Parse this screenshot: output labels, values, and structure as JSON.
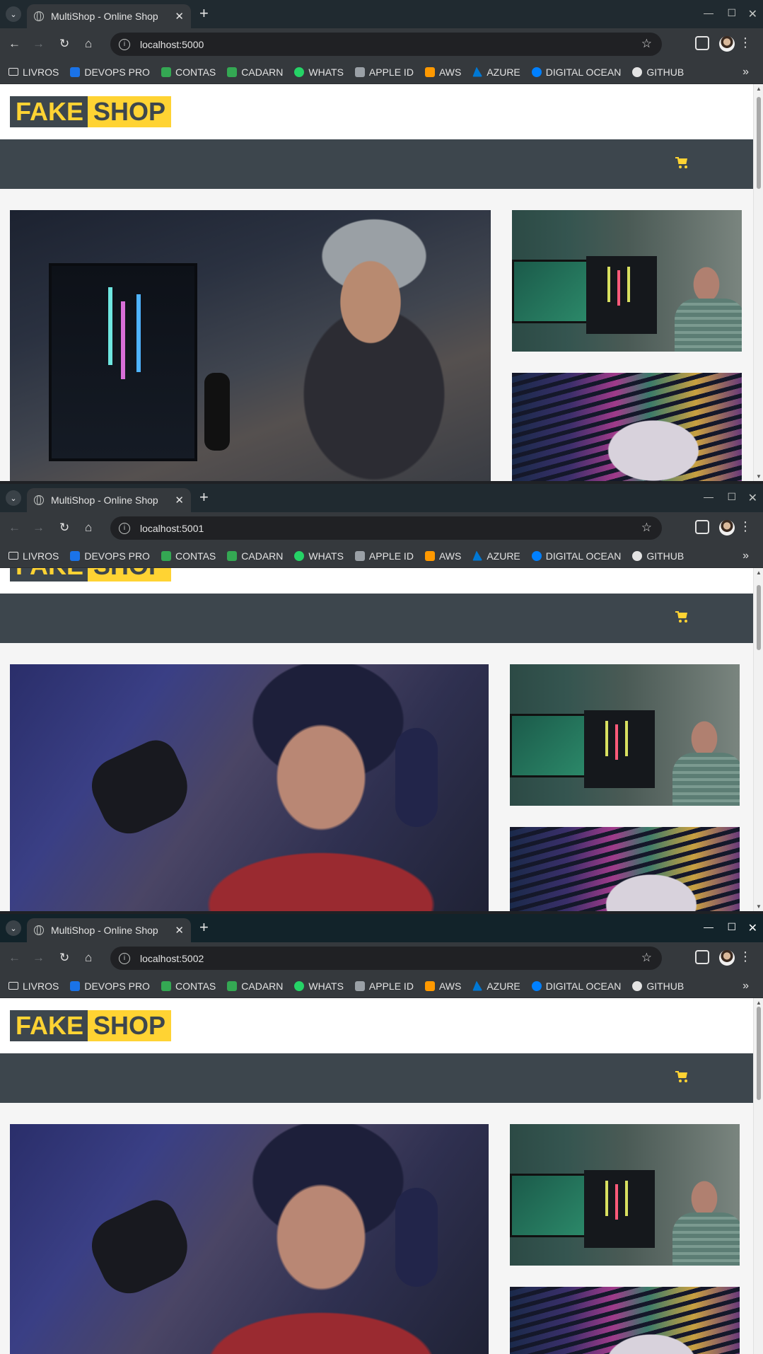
{
  "browser": {
    "tab_title": "MultiShop - Online Shop",
    "tab_close": "✕",
    "new_tab": "+",
    "tab_list_icon": "chevron-down",
    "window_controls": {
      "minimize": "—",
      "maximize": "☐",
      "close": "✕"
    },
    "bookmarks": [
      {
        "label": "LIVROS",
        "icon": "folder-icon",
        "color": "#e3e3e3"
      },
      {
        "label": "DEVOPS PRO",
        "icon": "infinity-icon",
        "color": "#1a73e8"
      },
      {
        "label": "CONTAS",
        "icon": "sheets-icon",
        "color": "#34a853"
      },
      {
        "label": "CADARN",
        "icon": "sheets-icon",
        "color": "#34a853"
      },
      {
        "label": "WHATS",
        "icon": "whatsapp-icon",
        "color": "#25d366"
      },
      {
        "label": "APPLE ID",
        "icon": "apple-icon",
        "color": "#9aa0a6"
      },
      {
        "label": "AWS",
        "icon": "aws-icon",
        "color": "#ff9900"
      },
      {
        "label": "AZURE",
        "icon": "azure-icon",
        "color": "#0078d4"
      },
      {
        "label": "DIGITAL OCEAN",
        "icon": "digitalocean-icon",
        "color": "#0080ff"
      },
      {
        "label": "GITHUB",
        "icon": "github-icon",
        "color": "#e3e3e3"
      }
    ],
    "bookmarks_more": "»"
  },
  "windows": [
    {
      "url": "localhost:5000"
    },
    {
      "url": "localhost:5001"
    },
    {
      "url": "localhost:5002"
    }
  ],
  "site": {
    "logo_part1": "FAKE",
    "logo_part2": "SHOP",
    "brand_yellow": "#ffd333",
    "brand_dark": "#3d464d",
    "cart_icon": "shopping-cart-icon"
  }
}
